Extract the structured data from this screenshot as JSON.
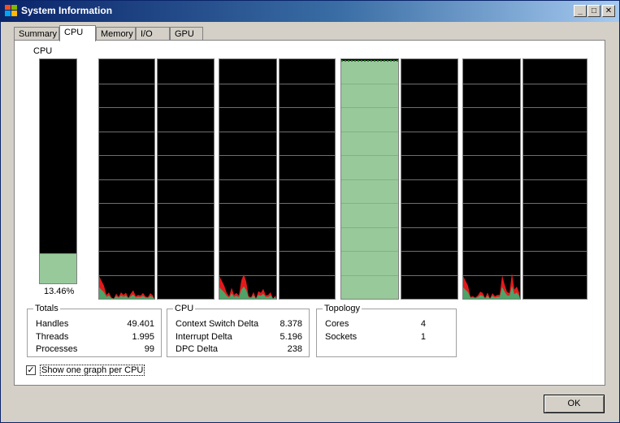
{
  "window": {
    "title": "System Information"
  },
  "titlebar_buttons": {
    "minimize": "_",
    "maximize": "□",
    "close": "✕"
  },
  "tabs": [
    {
      "label": "Summary",
      "active": false
    },
    {
      "label": "CPU",
      "active": true
    },
    {
      "label": "Memory",
      "active": false
    },
    {
      "label": "I/O",
      "active": false
    },
    {
      "label": "GPU",
      "active": false
    }
  ],
  "cpu": {
    "title": "CPU",
    "usage_percent_label": "13.46%",
    "usage_fraction": 0.1346,
    "graph_color_fill": "#98c99b",
    "graph_color_kernel": "#e31a1c",
    "graph_color_user": "#3cb371",
    "cpu_graphs": [
      {
        "usage": "low-activity"
      },
      {
        "usage": "idle"
      },
      {
        "usage": "low-activity"
      },
      {
        "usage": "idle"
      },
      {
        "usage": "full"
      },
      {
        "usage": "idle"
      },
      {
        "usage": "low-activity"
      },
      {
        "usage": "idle"
      }
    ]
  },
  "totals": {
    "title": "Totals",
    "rows": [
      {
        "label": "Handles",
        "value": "49.401"
      },
      {
        "label": "Threads",
        "value": "1.995"
      },
      {
        "label": "Processes",
        "value": "99"
      }
    ]
  },
  "cpu_stats": {
    "title": "CPU",
    "rows": [
      {
        "label": "Context Switch Delta",
        "value": "8.378"
      },
      {
        "label": "Interrupt Delta",
        "value": "5.196"
      },
      {
        "label": "DPC Delta",
        "value": "238"
      }
    ]
  },
  "topology": {
    "title": "Topology",
    "rows": [
      {
        "label": "Cores",
        "value": "4"
      },
      {
        "label": "Sockets",
        "value": "1"
      }
    ]
  },
  "options": {
    "show_one_graph_per_cpu": "Show one graph per CPU",
    "checked": true,
    "check_mark": "✓"
  },
  "buttons": {
    "ok": "OK"
  }
}
